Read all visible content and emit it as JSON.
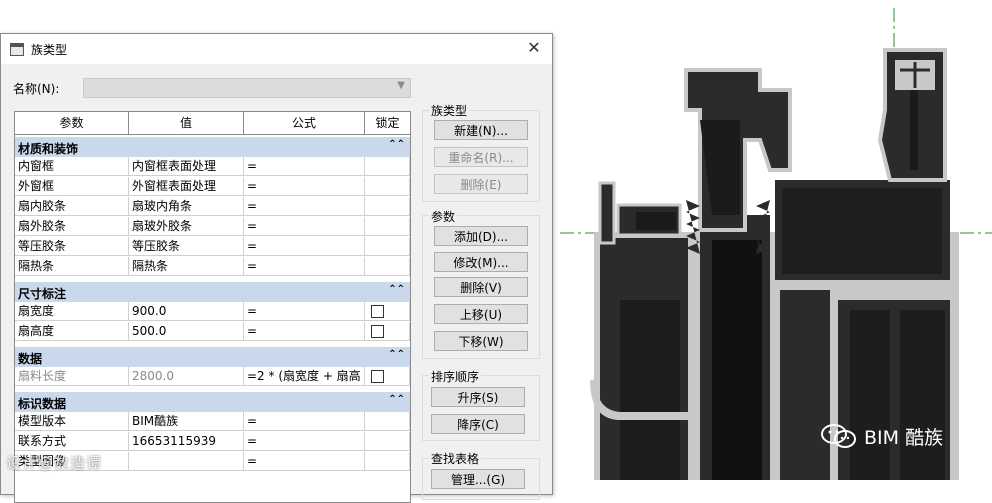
{
  "dialog": {
    "title": "族类型",
    "close_glyph": "✕",
    "name_label": "名称(N):",
    "name_value": ""
  },
  "table": {
    "headers": [
      "参数",
      "值",
      "公式",
      "锁定"
    ],
    "groups": [
      {
        "name": "材质和装饰",
        "collapse": "⌃⌃",
        "rows": [
          {
            "param": "内窗框",
            "value": "内窗框表面处理",
            "formula": "="
          },
          {
            "param": "外窗框",
            "value": "外窗框表面处理",
            "formula": "="
          },
          {
            "param": "扇内胶条",
            "value": "扇玻内角条",
            "formula": "="
          },
          {
            "param": "扇外胶条",
            "value": "扇玻外胶条",
            "formula": "="
          },
          {
            "param": "等压胶条",
            "value": "等压胶条",
            "formula": "="
          },
          {
            "param": "隔热条",
            "value": "隔热条",
            "formula": "="
          }
        ]
      },
      {
        "name": "尺寸标注",
        "collapse": "⌃⌃",
        "rows": [
          {
            "param": "扇宽度",
            "value": "900.0",
            "formula": "=",
            "lock": false
          },
          {
            "param": "扇高度",
            "value": "500.0",
            "formula": "=",
            "lock": false
          }
        ]
      },
      {
        "name": "数据",
        "collapse": "⌃⌃",
        "rows": [
          {
            "param": "扇料长度",
            "value": "2800.0",
            "formula": "=2 * (扇宽度 + 扇高",
            "lock": false,
            "dim": true
          }
        ]
      },
      {
        "name": "标识数据",
        "collapse": "⌃⌃",
        "rows": [
          {
            "param": "模型版本",
            "value": "BIM酷族",
            "formula": "="
          },
          {
            "param": "联系方式",
            "value": "16653115939",
            "formula": "="
          },
          {
            "param": "类型图像",
            "value": "",
            "formula": "="
          }
        ]
      }
    ]
  },
  "panel": {
    "family_types": {
      "label": "族类型",
      "new": "新建(N)...",
      "rename": "重命名(R)...",
      "delete": "删除(E)"
    },
    "params": {
      "label": "参数",
      "add": "添加(D)...",
      "modify": "修改(M)...",
      "delete": "删除(V)",
      "move_up": "上移(U)",
      "move_down": "下移(W)"
    },
    "sort": {
      "label": "排序顺序",
      "asc": "升序(S)",
      "desc": "降序(C)"
    },
    "lookup": {
      "label": "查找表格",
      "manage": "管理...(G)"
    }
  },
  "watermarks": {
    "left": "设计@数造谭",
    "right": "BIM 酷族"
  },
  "colors": {
    "group_header": "#c9d8ea",
    "profile_dark": "#2b2b2b",
    "profile_light": "#c8c8c8",
    "guide_line": "#2e8b2e"
  }
}
